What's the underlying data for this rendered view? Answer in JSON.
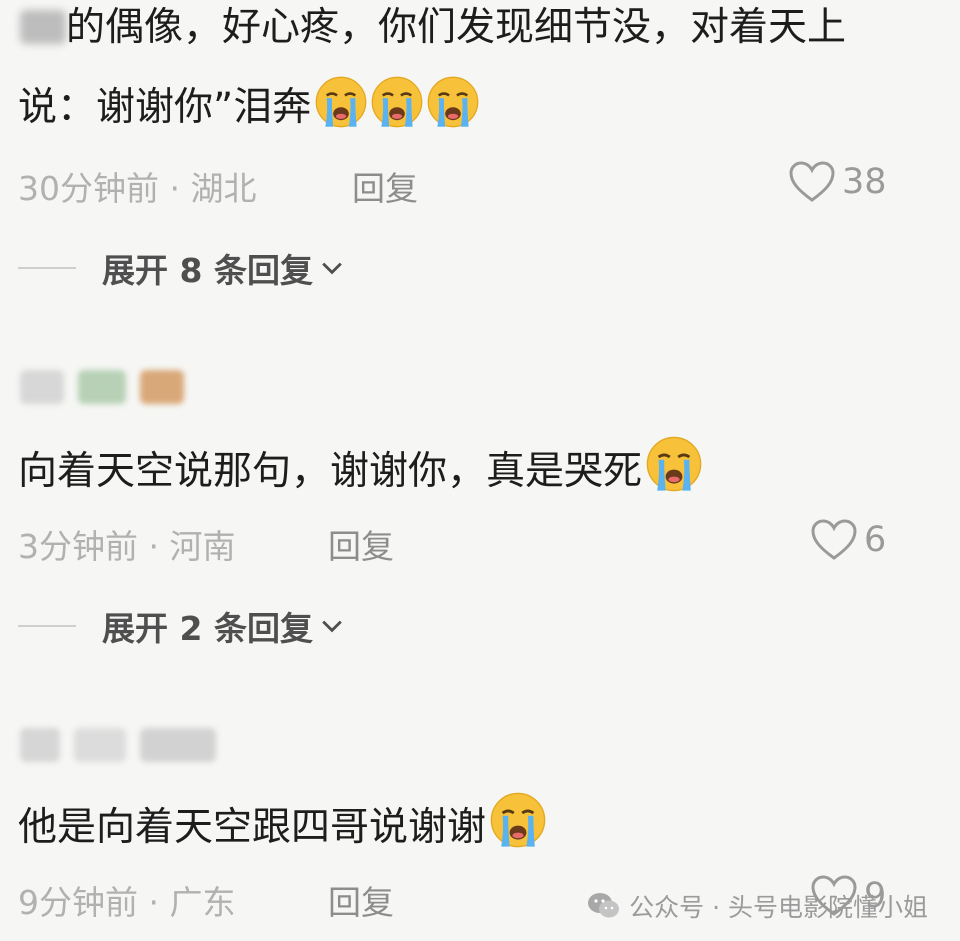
{
  "comments": [
    {
      "text": "的偶像，好心疼，你们发现细节没，对着天上",
      "text2": "说：谢谢你”泪奔",
      "meta": "30分钟前 · 湖北",
      "reply": "回复",
      "likes": "38",
      "expand": "展开 8 条回复"
    },
    {
      "text": "向着天空说那句，谢谢你，真是哭死",
      "meta": "3分钟前 · 河南",
      "reply": "回复",
      "likes": "6",
      "expand": "展开 2 条回复"
    },
    {
      "text": "他是向着天空跟四哥说谢谢",
      "meta": "9分钟前 · 广东",
      "reply": "回复",
      "likes": "9"
    }
  ],
  "watermark": "公众号 · 头号电影院懂小姐",
  "icons": [
    "heart-icon",
    "chevron-down-icon",
    "crying-face-emoji",
    "wechat-icon"
  ],
  "colors": {
    "background": "#f6f6f4",
    "meta": "#b1b1b1",
    "emoji": "#f7c23a"
  }
}
